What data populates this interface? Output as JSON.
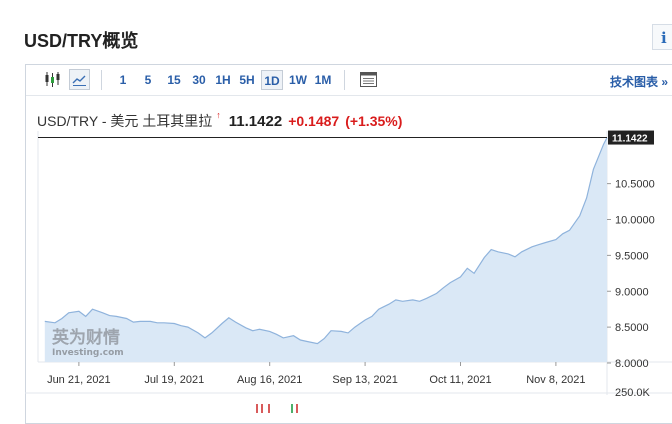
{
  "page": {
    "title": "USD/TRY概览"
  },
  "info_icon_glyph": "i",
  "toolbar": {
    "chart_type_icons": [
      "candlestick-icon",
      "area-chart-icon"
    ],
    "timeframes": [
      "1",
      "5",
      "15",
      "30",
      "1H",
      "5H",
      "1D",
      "1W",
      "1M"
    ],
    "active_timeframe": "1D",
    "calendar_icon": "table-icon",
    "tech_chart_label": "技术图表",
    "tech_chart_arrow": "»"
  },
  "quote": {
    "name": "USD/TRY - 美元 土耳其里拉",
    "arrow": "↑",
    "price": "11.1422",
    "change": "+0.1487",
    "change_pct": "(+1.35%)"
  },
  "watermark": {
    "cn": "英为财情",
    "en": "Investing.com"
  },
  "colors": {
    "up": "#d91c1c",
    "line": "#8fb3dc",
    "fill": "#d8e7f6",
    "link": "#2a5ea8"
  },
  "chart_data": {
    "type": "area",
    "title": "",
    "x_ticks": [
      "Jun 21, 2021",
      "Jul 19, 2021",
      "Aug 16, 2021",
      "Sep 13, 2021",
      "Oct 11, 2021",
      "Nov 8, 2021"
    ],
    "y_ticks": [
      "10.5000",
      "10.0000",
      "9.5000",
      "9.0000",
      "8.5000",
      "8.0000"
    ],
    "ylim": [
      8.0,
      11.25
    ],
    "last_value_label": "11.1422",
    "volume_label": "250.0K",
    "grid": false,
    "x": [
      "2021-06-11",
      "2021-06-14",
      "2021-06-16",
      "2021-06-18",
      "2021-06-21",
      "2021-06-23",
      "2021-06-25",
      "2021-06-28",
      "2021-06-30",
      "2021-07-02",
      "2021-07-05",
      "2021-07-07",
      "2021-07-09",
      "2021-07-12",
      "2021-07-14",
      "2021-07-16",
      "2021-07-19",
      "2021-07-21",
      "2021-07-23",
      "2021-07-26",
      "2021-07-28",
      "2021-07-30",
      "2021-08-02",
      "2021-08-04",
      "2021-08-06",
      "2021-08-09",
      "2021-08-11",
      "2021-08-13",
      "2021-08-16",
      "2021-08-18",
      "2021-08-20",
      "2021-08-23",
      "2021-08-25",
      "2021-08-27",
      "2021-08-30",
      "2021-09-01",
      "2021-09-03",
      "2021-09-06",
      "2021-09-08",
      "2021-09-10",
      "2021-09-13",
      "2021-09-15",
      "2021-09-17",
      "2021-09-20",
      "2021-09-22",
      "2021-09-24",
      "2021-09-27",
      "2021-09-29",
      "2021-10-01",
      "2021-10-04",
      "2021-10-06",
      "2021-10-08",
      "2021-10-11",
      "2021-10-13",
      "2021-10-15",
      "2021-10-18",
      "2021-10-20",
      "2021-10-22",
      "2021-10-25",
      "2021-10-27",
      "2021-10-29",
      "2021-11-01",
      "2021-11-03",
      "2021-11-05",
      "2021-11-08",
      "2021-11-10",
      "2021-11-12",
      "2021-11-15",
      "2021-11-17",
      "2021-11-19",
      "2021-11-22",
      "2021-11-23"
    ],
    "values": [
      8.58,
      8.56,
      8.62,
      8.7,
      8.72,
      8.65,
      8.75,
      8.7,
      8.66,
      8.65,
      8.62,
      8.57,
      8.58,
      8.58,
      8.56,
      8.56,
      8.55,
      8.52,
      8.5,
      8.42,
      8.35,
      8.42,
      8.55,
      8.63,
      8.57,
      8.49,
      8.45,
      8.47,
      8.44,
      8.4,
      8.35,
      8.38,
      8.32,
      8.3,
      8.27,
      8.34,
      8.45,
      8.44,
      8.42,
      8.5,
      8.6,
      8.65,
      8.75,
      8.82,
      8.88,
      8.86,
      8.88,
      8.86,
      8.9,
      8.97,
      9.05,
      9.12,
      9.2,
      9.32,
      9.25,
      9.47,
      9.58,
      9.55,
      9.52,
      9.48,
      9.55,
      9.62,
      9.65,
      9.68,
      9.72,
      9.8,
      9.85,
      10.05,
      10.3,
      10.7,
      11.05,
      11.14
    ]
  }
}
